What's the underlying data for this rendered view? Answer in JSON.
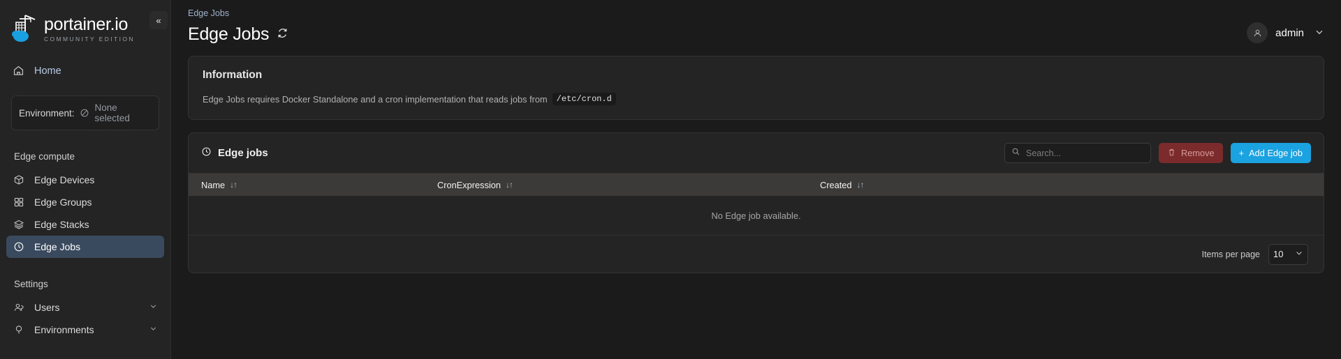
{
  "sidebar": {
    "logo": {
      "title": "portainer.io",
      "subtitle": "COMMUNITY EDITION"
    },
    "home": {
      "label": "Home",
      "icon": "home-icon"
    },
    "environment": {
      "label": "Environment:",
      "value": "None selected",
      "icon": "none-selected-icon"
    },
    "sections": [
      {
        "title": "Edge compute",
        "items": [
          {
            "label": "Edge Devices",
            "icon": "cube-icon",
            "active": false
          },
          {
            "label": "Edge Groups",
            "icon": "grid-icon",
            "active": false
          },
          {
            "label": "Edge Stacks",
            "icon": "layers-icon",
            "active": false
          },
          {
            "label": "Edge Jobs",
            "icon": "clock-icon",
            "active": true
          }
        ]
      },
      {
        "title": "Settings",
        "items": [
          {
            "label": "Users",
            "icon": "users-icon",
            "active": false,
            "caret": "chevron-down"
          },
          {
            "label": "Environments",
            "icon": "plug-icon",
            "active": false,
            "caret": "chevron-down"
          }
        ]
      }
    ]
  },
  "header": {
    "collapse_icon": "«",
    "breadcrumb": "Edge Jobs",
    "title": "Edge Jobs",
    "refresh_icon": "refresh-icon",
    "user": {
      "name": "admin",
      "caret": "⌄"
    }
  },
  "information": {
    "title": "Information",
    "text": "Edge Jobs requires Docker Standalone and a cron implementation that reads jobs from",
    "code": "/etc/cron.d"
  },
  "edge_jobs": {
    "title": "Edge jobs",
    "search": {
      "placeholder": "Search...",
      "value": ""
    },
    "remove_label": "Remove",
    "add_label": "Add Edge job",
    "add_icon": "+",
    "columns": [
      {
        "label": "Name",
        "sort": "↓↑"
      },
      {
        "label": "CronExpression",
        "sort": "↓↑"
      },
      {
        "label": "Created",
        "sort": "↓↑"
      }
    ],
    "empty_message": "No Edge job available.",
    "footer": {
      "items_per_page_label": "Items per page",
      "items_per_page_value": "10"
    }
  },
  "colors": {
    "accent": "#1ba2e0",
    "danger": "#7b2b2b",
    "active_nav": "#3a4a5e"
  }
}
